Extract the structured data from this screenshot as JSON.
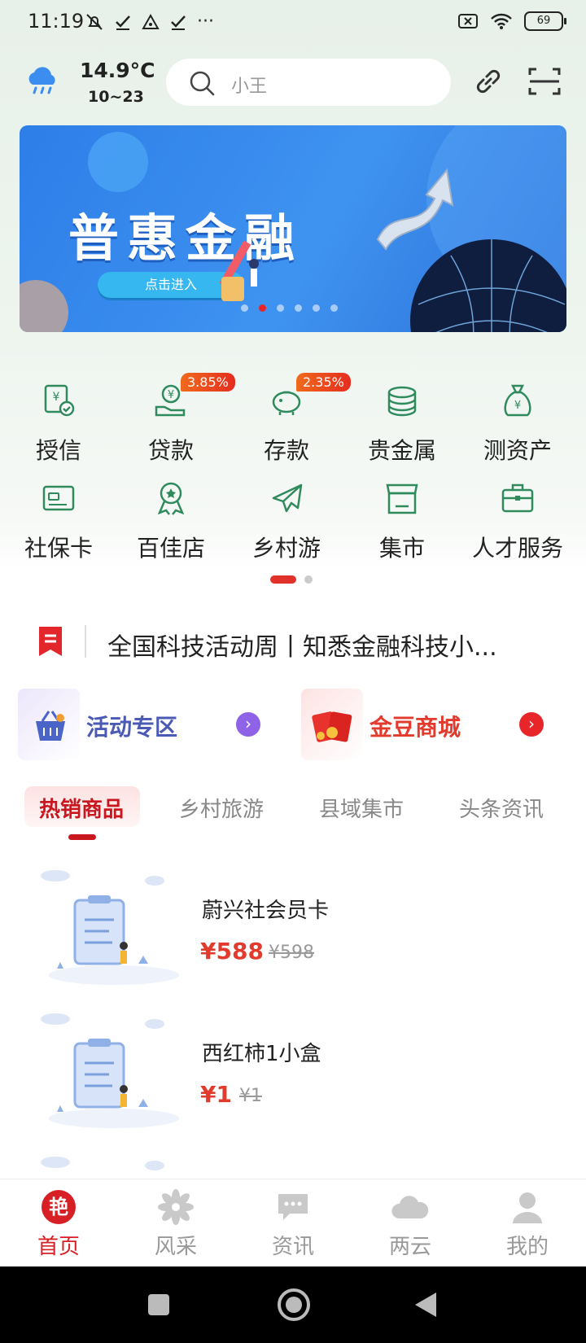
{
  "status_bar": {
    "time": "11:19",
    "battery": "69"
  },
  "weather": {
    "temp": "14.9°C",
    "range": "10~23",
    "icon": "cloud-rain-icon"
  },
  "search": {
    "placeholder": "小王"
  },
  "banner": {
    "title": "普惠金融",
    "button": "点击进入",
    "slide_count": 6,
    "active_slide": 2
  },
  "grid": [
    {
      "label": "授信",
      "icon": "credit-icon",
      "badge": ""
    },
    {
      "label": "贷款",
      "icon": "loan-icon",
      "badge": "3.85%"
    },
    {
      "label": "存款",
      "icon": "piggy-bank-icon",
      "badge": "2.35%"
    },
    {
      "label": "贵金属",
      "icon": "coins-icon",
      "badge": ""
    },
    {
      "label": "测资产",
      "icon": "money-bag-icon",
      "badge": ""
    },
    {
      "label": "社保卡",
      "icon": "card-icon",
      "badge": ""
    },
    {
      "label": "百佳店",
      "icon": "medal-icon",
      "badge": ""
    },
    {
      "label": "乡村游",
      "icon": "plane-icon",
      "badge": ""
    },
    {
      "label": "集市",
      "icon": "store-icon",
      "badge": ""
    },
    {
      "label": "人才服务",
      "icon": "briefcase-icon",
      "badge": ""
    }
  ],
  "notice": {
    "text": "全国科技活动周丨知悉金融科技小..."
  },
  "promos": [
    {
      "label": "活动专区",
      "color": "#4b5bb5",
      "arrow_color": "#8f63e8"
    },
    {
      "label": "金豆商城",
      "color": "#e23b2e",
      "arrow_color": "#e8262a"
    }
  ],
  "tabs": [
    "热销商品",
    "乡村旅游",
    "县域集市",
    "头条资讯"
  ],
  "products": [
    {
      "name": "蔚兴社会员卡",
      "price": "¥588",
      "old_price": "¥598"
    },
    {
      "name": "西红柿1小盒",
      "price": "¥1",
      "old_price": "¥1"
    }
  ],
  "bottom_nav": [
    {
      "label": "首页",
      "icon": "home-logo-icon",
      "active": true
    },
    {
      "label": "风采",
      "icon": "flower-icon",
      "active": false
    },
    {
      "label": "资讯",
      "icon": "chat-icon",
      "active": false
    },
    {
      "label": "两云",
      "icon": "cloud-icon",
      "active": false
    },
    {
      "label": "我的",
      "icon": "user-icon",
      "active": false
    }
  ],
  "colors": {
    "accent": "#d71f26",
    "brand_blue": "#2d7ee8"
  }
}
